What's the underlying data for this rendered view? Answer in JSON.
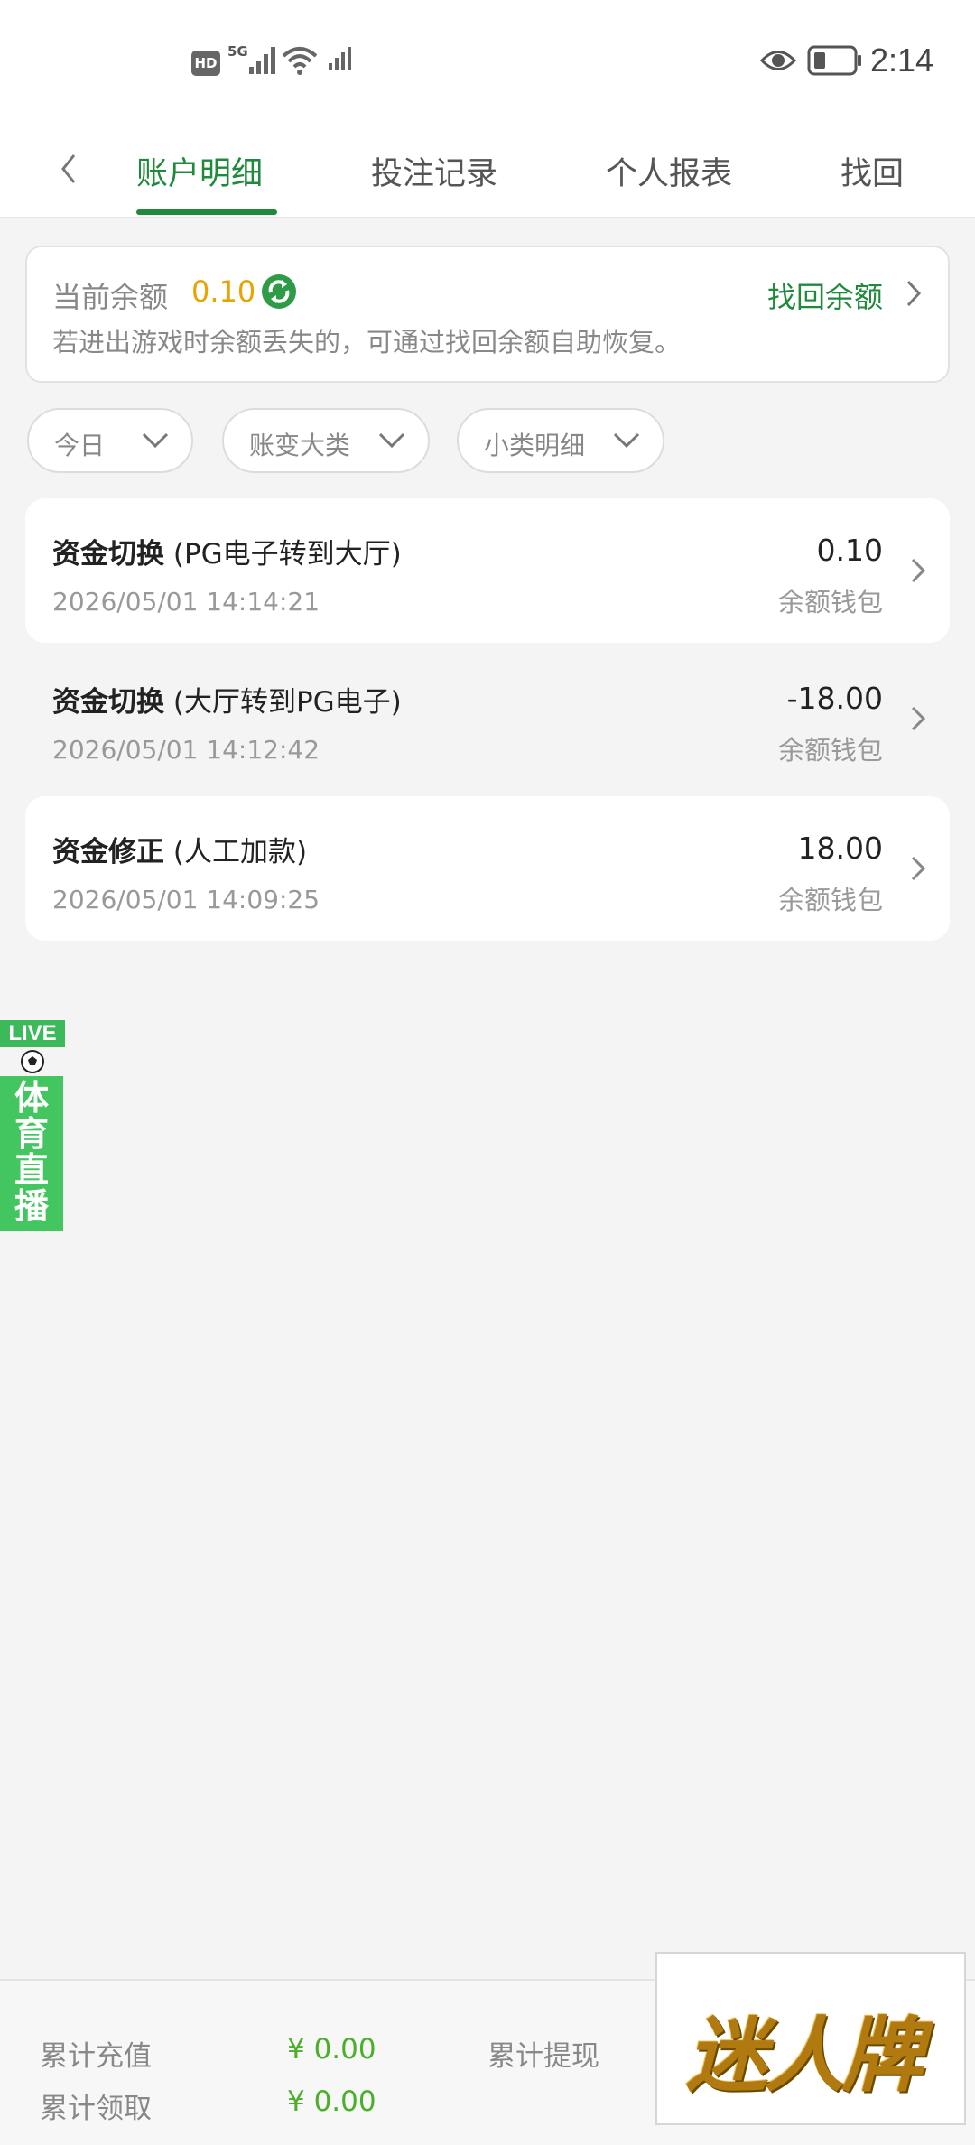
{
  "status_bar": {
    "hd": "HD",
    "network": "5G",
    "time": "2:14"
  },
  "tabs": [
    {
      "label": "账户明细",
      "active": true
    },
    {
      "label": "投注记录",
      "active": false
    },
    {
      "label": "个人报表",
      "active": false
    },
    {
      "label": "找回",
      "active": false
    }
  ],
  "balance": {
    "label": "当前余额",
    "value": "0.10",
    "recover_label": "找回余额",
    "hint": "若进出游戏时余额丢失的，可通过找回余额自助恢复。"
  },
  "filters": [
    {
      "label": "今日"
    },
    {
      "label": "账变大类"
    },
    {
      "label": "小类明细"
    }
  ],
  "records": [
    {
      "title": "资金切换",
      "subtitle": "(PG电子转到大厅)",
      "time": "2026/05/01 14:14:21",
      "amount": "0.10",
      "wallet": "余额钱包"
    },
    {
      "title": "资金切换",
      "subtitle": "(大厅转到PG电子)",
      "time": "2026/05/01 14:12:42",
      "amount": "-18.00",
      "wallet": "余额钱包"
    },
    {
      "title": "资金修正",
      "subtitle": "(人工加款)",
      "time": "2026/05/01 14:09:25",
      "amount": "18.00",
      "wallet": "余额钱包"
    }
  ],
  "live_float": {
    "tag": "LIVE",
    "label": "体育直播"
  },
  "summary": {
    "recharge_label": "累计充值",
    "recharge_value": "¥ 0.00",
    "withdraw_label": "累计提现",
    "claim_label": "累计领取",
    "claim_value": "¥ 0.00"
  },
  "promo": {
    "text": "迷人牌"
  },
  "colors": {
    "accent_green": "#1f8a3c",
    "balance_yellow": "#e8a400",
    "summary_green": "#4caf2a"
  }
}
